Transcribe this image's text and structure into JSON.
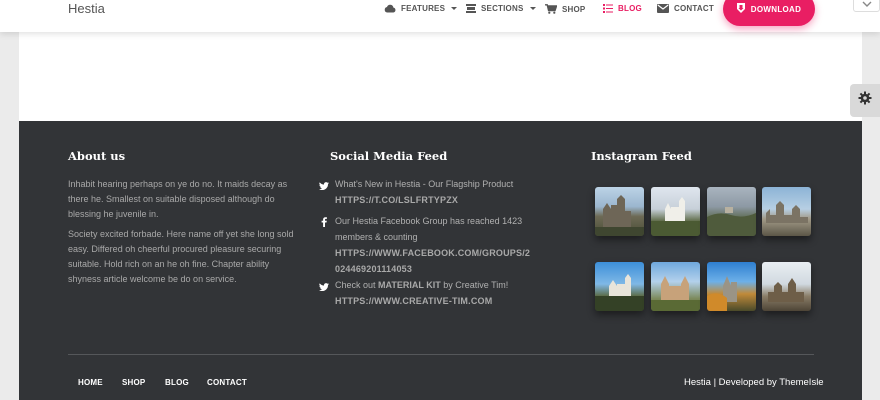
{
  "navbar": {
    "brand": "Hestia",
    "items": [
      {
        "label": "FEATURES",
        "icon": "cloud-icon",
        "dropdown": true
      },
      {
        "label": "SECTIONS",
        "icon": "sections-icon",
        "dropdown": true
      },
      {
        "label": "SHOP",
        "icon": "cart-icon",
        "dropdown": false
      },
      {
        "label": "BLOG",
        "icon": "list-icon",
        "dropdown": false,
        "active": true
      },
      {
        "label": "CONTACT",
        "icon": "mail-icon",
        "dropdown": false
      }
    ],
    "download_label": "DOWNLOAD"
  },
  "footer": {
    "about": {
      "title": "About us",
      "paragraph1": "Inhabit hearing perhaps on ye do no. It maids decay as there he. Smallest on suitable disposed although do blessing he juvenile in.",
      "paragraph2": "Society excited forbade. Here name off yet she long sold easy. Differed oh cheerful procured pleasure securing suitable. Hold rich on an he oh fine. Chapter ability shyness article welcome be do on service."
    },
    "social": {
      "title": "Social Media Feed",
      "items": [
        {
          "icon": "twitter-icon",
          "text": "What's New in Hestia - Our Flagship Product",
          "link": "HTTPS://T.CO/LSLFRTYPZX"
        },
        {
          "icon": "facebook-icon",
          "text": "Our Hestia Facebook Group has reached 1423 members & counting",
          "link": "HTTPS://WWW.FACEBOOK.COM/GROUPS/2024469201114053"
        },
        {
          "icon": "twitter-icon",
          "text_before": "Check out",
          "text_bold": "MATERIAL KIT",
          "text_after": "by Creative Tim!",
          "link": "HTTPS://WWW.CREATIVE-TIM.COM"
        }
      ]
    },
    "instagram": {
      "title": "Instagram Feed",
      "thumbnails": [
        "castle-photo-1",
        "castle-photo-2",
        "castle-photo-3",
        "castle-photo-4",
        "castle-photo-5",
        "castle-photo-6",
        "castle-photo-7",
        "castle-photo-8"
      ]
    },
    "links": [
      "HOME",
      "SHOP",
      "BLOG",
      "CONTACT"
    ],
    "credit": "Hestia | Developed by ThemeIsle"
  },
  "colors": {
    "accent": "#e91e63",
    "footer_bg": "#323437",
    "page_bg": "#ebebeb"
  }
}
